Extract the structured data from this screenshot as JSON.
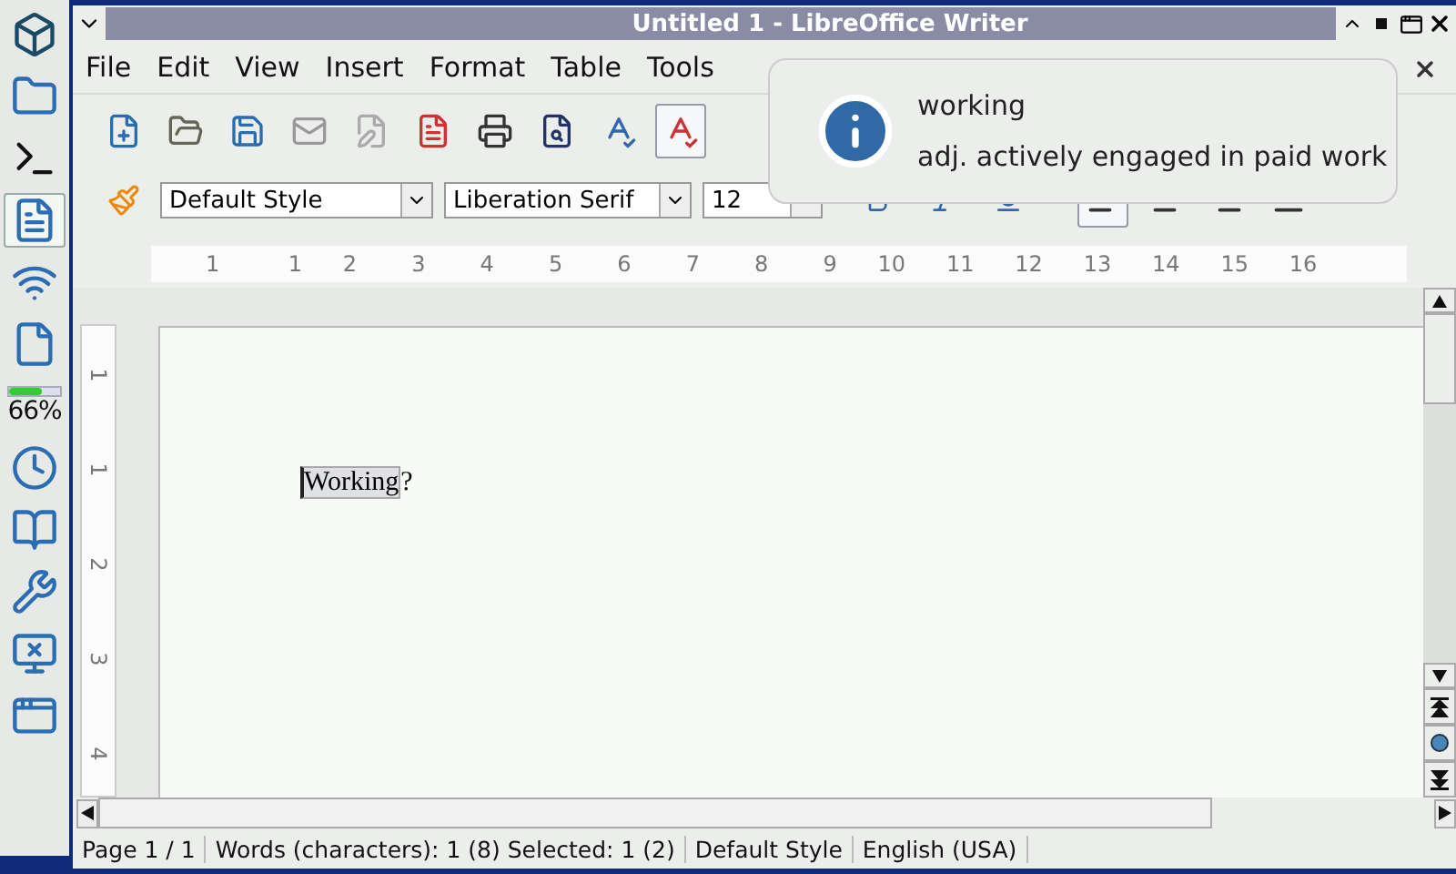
{
  "dock": {
    "items": [
      {
        "kind": "logo"
      },
      {
        "kind": "folder"
      },
      {
        "kind": "terminal"
      },
      {
        "kind": "writer",
        "selected": true
      },
      {
        "kind": "wifi"
      },
      {
        "kind": "document"
      },
      {
        "kind": "battery",
        "level": 0.66,
        "reading": "66%"
      },
      {
        "kind": "clock"
      },
      {
        "kind": "book"
      },
      {
        "kind": "tools"
      },
      {
        "kind": "network"
      },
      {
        "kind": "desktop"
      }
    ]
  },
  "window": {
    "title": "Untitled 1 - LibreOffice Writer"
  },
  "menu": [
    {
      "label": "File"
    },
    {
      "label": "Edit"
    },
    {
      "label": "View"
    },
    {
      "label": "Insert"
    },
    {
      "label": "Format"
    },
    {
      "label": "Table"
    },
    {
      "label": "Tools"
    }
  ],
  "toolbar": [
    {
      "kind": "new",
      "pressed": false
    },
    {
      "kind": "open",
      "pressed": false
    },
    {
      "kind": "save",
      "pressed": false
    },
    {
      "kind": "email",
      "pressed": false
    },
    {
      "kind": "edit",
      "pressed": false
    },
    {
      "kind": "pdf",
      "pressed": false
    },
    {
      "kind": "print",
      "pressed": false
    },
    {
      "kind": "preview",
      "pressed": false
    },
    {
      "kind": "spellcheck",
      "pressed": false
    },
    {
      "kind": "autospell",
      "pressed": true
    }
  ],
  "formatting": {
    "paragraph_style": "Default Style",
    "font": "Liberation Serif",
    "size": "12",
    "alignment": [
      {
        "kind": "left",
        "selected": true
      },
      {
        "kind": "center",
        "selected": false
      },
      {
        "kind": "right",
        "selected": false
      },
      {
        "kind": "justify",
        "selected": false
      }
    ]
  },
  "ruler": {
    "indent_label": "1",
    "labels": [
      "1",
      "2",
      "3",
      "4",
      "5",
      "6",
      "7",
      "8",
      "9",
      "10",
      "11",
      "12",
      "13",
      "14",
      "15",
      "16"
    ]
  },
  "vertical_ruler": {
    "labels": [
      "1",
      "1",
      "2",
      "3",
      "4"
    ]
  },
  "document": {
    "selected_text": "Working",
    "text": "?"
  },
  "status_bar": {
    "page": "Page 1 / 1",
    "words": "Words (characters): 1 (8) Selected: 1 (2)",
    "style": "Default Style",
    "language": "English (USA)"
  },
  "notification": {
    "title": "working",
    "body": "adj. actively engaged in paid work"
  }
}
